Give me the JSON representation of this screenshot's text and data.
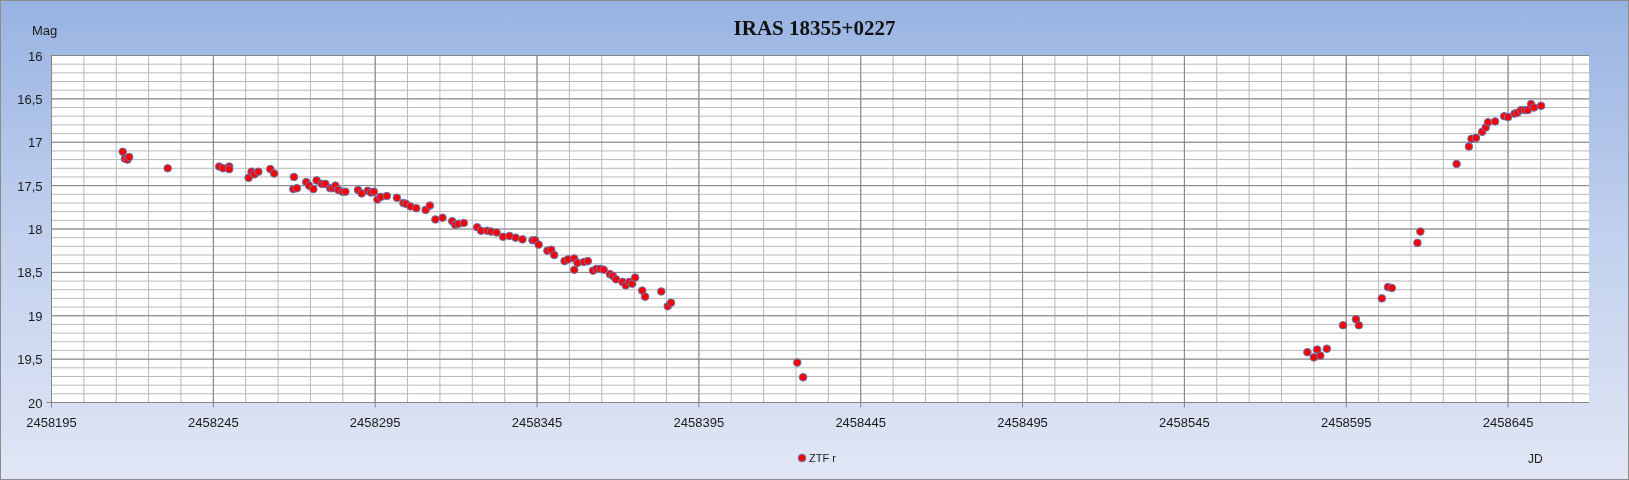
{
  "chart": {
    "chart_data": {
      "type": "scatter",
      "title": "IRAS 18355+0227",
      "xlabel": "JD",
      "ylabel": "Mag",
      "grid": true,
      "xlim": [
        2458195,
        2458670
      ],
      "ylim": [
        20,
        16
      ],
      "xticks": [
        2458195,
        2458245,
        2458295,
        2458345,
        2458395,
        2458445,
        2458495,
        2458545,
        2458595,
        2458645
      ],
      "yticks": [
        {
          "value": 16,
          "label": "16"
        },
        {
          "value": 16.5,
          "label": "16,5"
        },
        {
          "value": 17,
          "label": "17"
        },
        {
          "value": 17.5,
          "label": "17,5"
        },
        {
          "value": 18,
          "label": "18"
        },
        {
          "value": 18.5,
          "label": "18,5"
        },
        {
          "value": 19,
          "label": "19"
        },
        {
          "value": 19.5,
          "label": "19,5"
        },
        {
          "value": 20,
          "label": "20"
        }
      ],
      "x": [
        2458217.0,
        2458217.7,
        2458218.5,
        2458219.0,
        2458230.9,
        2458246.8,
        2458248.0,
        2458249.9,
        2458249.9,
        2458255.9,
        2458256.8,
        2458257.7,
        2458258.9,
        2458262.6,
        2458263.8,
        2458269.9,
        2458269.7,
        2458270.8,
        2458273.7,
        2458274.6,
        2458275.9,
        2458276.9,
        2458278.5,
        2458279.6,
        2458281.1,
        2458281.9,
        2458282.7,
        2458283.6,
        2458284.9,
        2458285.8,
        2458289.7,
        2458290.8,
        2458292.7,
        2458293.7,
        2458294.6,
        2458295.7,
        2458296.7,
        2458298.6,
        2458301.7,
        2458303.7,
        2458304.5,
        2458305.9,
        2458307.7,
        2458310.6,
        2458311.9,
        2458313.6,
        2458315.8,
        2458318.8,
        2458319.7,
        2458320.7,
        2458322.4,
        2458326.5,
        2458327.7,
        2458329.6,
        2458330.8,
        2458332.5,
        2458334.5,
        2458336.5,
        2458338.4,
        2458340.5,
        2458343.6,
        2458344.4,
        2458345.5,
        2458348.2,
        2458349.4,
        2458350.3,
        2458353.5,
        2458354.6,
        2458356.5,
        2458356.5,
        2458357.5,
        2458359.5,
        2458360.7,
        2458362.3,
        2458363.4,
        2458364.5,
        2458365.6,
        2458367.5,
        2458368.4,
        2458369.4,
        2458371.4,
        2458372.4,
        2458373.5,
        2458374.4,
        2458375.3,
        2458377.5,
        2458378.4,
        2458383.4,
        2458385.4,
        2458386.4,
        2458425.4,
        2458427.2,
        2458583.0,
        2458585.0,
        2458586.0,
        2458587.0,
        2458589.0,
        2458594.0,
        2458598.0,
        2458598.9,
        2458606.0,
        2458607.9,
        2458609.1,
        2458617.0,
        2458617.9,
        2458629.1,
        2458632.9,
        2458633.7,
        2458635.1,
        2458637.0,
        2458638.1,
        2458638.8,
        2458641.0,
        2458643.8,
        2458645.0,
        2458647.0,
        2458647.9,
        2458649.0,
        2458650.2,
        2458651.1,
        2458652.1,
        2458653.0,
        2458655.2
      ],
      "series": [
        {
          "name": "ZTF r",
          "color": "#ff0000",
          "values": [
            17.11,
            17.19,
            17.2,
            17.17,
            17.3,
            17.28,
            17.3,
            17.28,
            17.31,
            17.41,
            17.34,
            17.37,
            17.34,
            17.31,
            17.36,
            17.4,
            17.54,
            17.53,
            17.46,
            17.5,
            17.54,
            17.44,
            17.48,
            17.48,
            17.53,
            17.53,
            17.5,
            17.55,
            17.57,
            17.57,
            17.55,
            17.59,
            17.56,
            17.58,
            17.57,
            17.66,
            17.63,
            17.62,
            17.64,
            17.7,
            17.71,
            17.74,
            17.76,
            17.78,
            17.73,
            17.89,
            17.87,
            17.91,
            17.95,
            17.94,
            17.93,
            17.98,
            18.02,
            18.02,
            18.03,
            18.04,
            18.09,
            18.08,
            18.1,
            18.12,
            18.13,
            18.13,
            18.18,
            18.25,
            18.24,
            18.3,
            18.37,
            18.35,
            18.34,
            18.47,
            18.39,
            18.38,
            18.37,
            18.48,
            18.46,
            18.46,
            18.47,
            18.52,
            18.54,
            18.58,
            18.61,
            18.65,
            18.61,
            18.63,
            18.56,
            18.71,
            18.78,
            18.72,
            18.89,
            18.85,
            19.54,
            19.71,
            19.42,
            19.48,
            19.39,
            19.46,
            19.38,
            19.11,
            19.04,
            19.11,
            18.8,
            18.67,
            18.68,
            18.16,
            18.03,
            17.25,
            17.05,
            16.96,
            16.95,
            16.88,
            16.83,
            16.77,
            16.76,
            16.7,
            16.71,
            16.67,
            16.66,
            16.63,
            16.63,
            16.63,
            16.56,
            16.6,
            16.58
          ]
        }
      ]
    }
  }
}
